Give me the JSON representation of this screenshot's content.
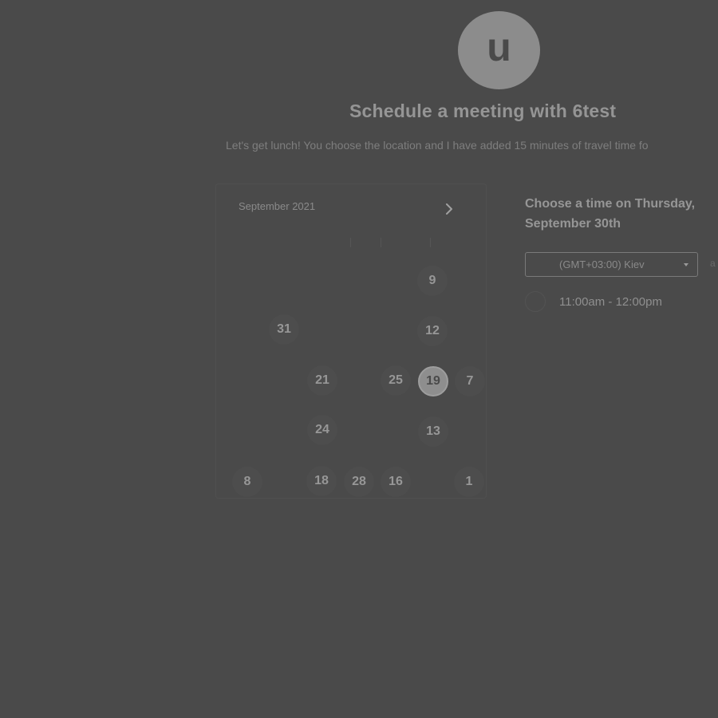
{
  "host": {
    "avatar_letter": "u",
    "title": "Schedule a meeting with 6test",
    "description": "Let's get lunch! You choose the location and I have added 15 minutes of travel time fo"
  },
  "calendar": {
    "month_label": "September 2021",
    "next_icon": "chevron-right-icon",
    "days": [
      {
        "label": "9"
      },
      {
        "label": "31"
      },
      {
        "label": "12"
      },
      {
        "label": "21"
      },
      {
        "label": "25"
      },
      {
        "label": "19",
        "selected": true
      },
      {
        "label": "7"
      },
      {
        "label": "24"
      },
      {
        "label": "13"
      },
      {
        "label": "8"
      },
      {
        "label": "18"
      },
      {
        "label": "28"
      },
      {
        "label": "16"
      },
      {
        "label": "1"
      }
    ]
  },
  "time_panel": {
    "heading": "Choose a time on Thursday, September 30th",
    "timezone": {
      "selected": "(GMT+03:00) Kiev",
      "caret_icon": "caret-down-icon"
    },
    "timezone_extra": "a",
    "slots": [
      {
        "label": "11:00am - 12:00pm"
      }
    ]
  }
}
